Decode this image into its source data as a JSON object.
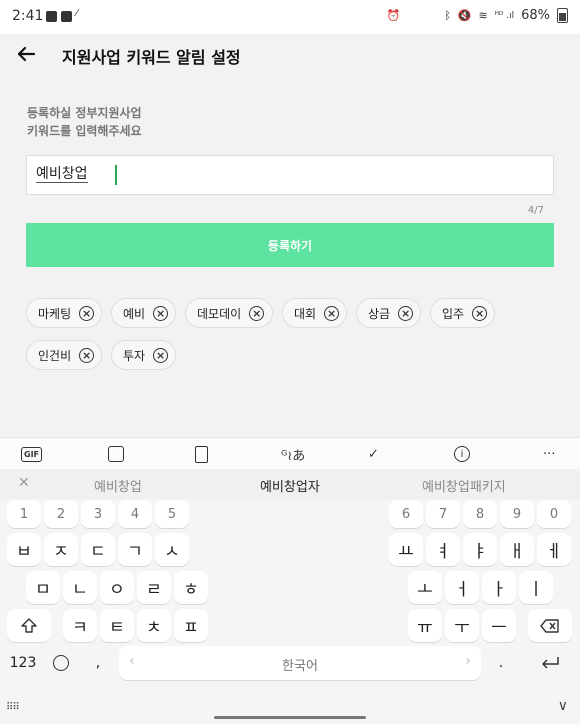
{
  "status": {
    "time": "2:41",
    "battery": "68%"
  },
  "header": {
    "title": "지원사업 키워드 알림 설정",
    "back_icon": "arrow-left-icon"
  },
  "description": {
    "line1": "등록하실 정부지원사업",
    "line2": "키워드를 입력해주세요"
  },
  "input": {
    "value": "예비창업",
    "counter": "4/7"
  },
  "register_button": {
    "label": "등록하기",
    "color": "#5ee29f"
  },
  "keywords": [
    "마케팅",
    "예비",
    "데모데이",
    "대회",
    "상금",
    "입주",
    "인건비",
    "투자"
  ],
  "chip_remove_icon": "circle-x-icon",
  "keyboard": {
    "toolbar": {
      "gif": "GIF"
    },
    "suggestions": [
      "예비창업",
      "예비창업자",
      "예비창업패키지"
    ],
    "number_keys_left": [
      "1",
      "2",
      "3",
      "4",
      "5"
    ],
    "number_keys_right": [
      "6",
      "7",
      "8",
      "9",
      "0"
    ],
    "row1_left": [
      "ㅂ",
      "ㅈ",
      "ㄷ",
      "ㄱ",
      "ㅅ"
    ],
    "row1_right": [
      "ㅛ",
      "ㅕ",
      "ㅑ",
      "ㅐ",
      "ㅔ"
    ],
    "row2_left": [
      "ㅁ",
      "ㄴ",
      "ㅇ",
      "ㄹ",
      "ㅎ"
    ],
    "row2_right": [
      "ㅗ",
      "ㅓ",
      "ㅏ",
      "ㅣ"
    ],
    "row3_left": [
      "ㅋ",
      "ㅌ",
      "ㅊ",
      "ㅍ"
    ],
    "row3_right": [
      "ㅠ",
      "ㅜ",
      "ㅡ"
    ],
    "mode_key": "123",
    "comma_key": ",",
    "space_label": "한국어",
    "period_key": "."
  }
}
